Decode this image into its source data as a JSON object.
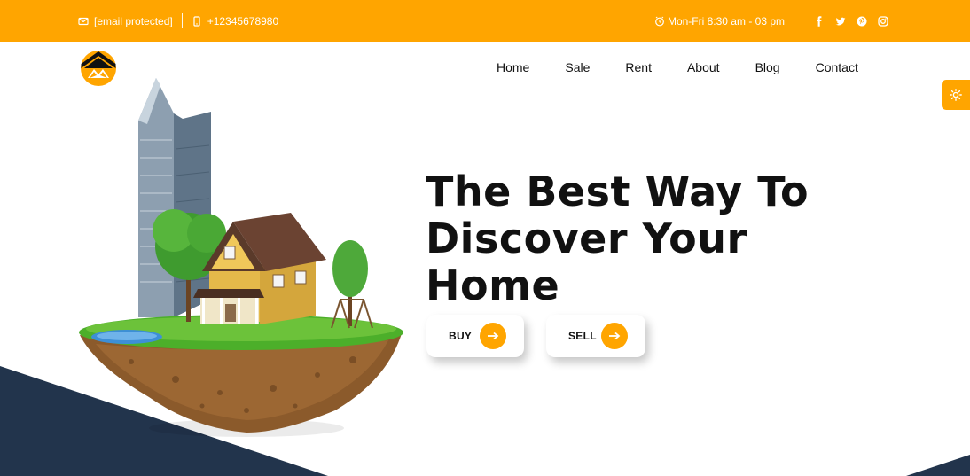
{
  "topbar": {
    "email": "[email protected]",
    "phone": "+12345678980",
    "hours": "Mon-Fri 8:30 am - 03 pm",
    "background_color": "#ffa500",
    "social_icons": [
      "facebook-icon",
      "twitter-icon",
      "pinterest-icon",
      "instagram-icon"
    ]
  },
  "nav": {
    "items": [
      {
        "label": "Home"
      },
      {
        "label": "Sale"
      },
      {
        "label": "Rent"
      },
      {
        "label": "About"
      },
      {
        "label": "Blog"
      },
      {
        "label": "Contact"
      }
    ]
  },
  "hero": {
    "title_lines": [
      "The Best Way To",
      "Discover Your",
      "Home"
    ],
    "buy_label": "BUY",
    "sell_label": "SELL"
  },
  "colors": {
    "accent": "#ffa500",
    "dark_navy": "#22344c",
    "text": "#111111"
  },
  "icons": {
    "theme_toggle": "sun-icon",
    "button_arrow": "arrow-right-icon"
  }
}
